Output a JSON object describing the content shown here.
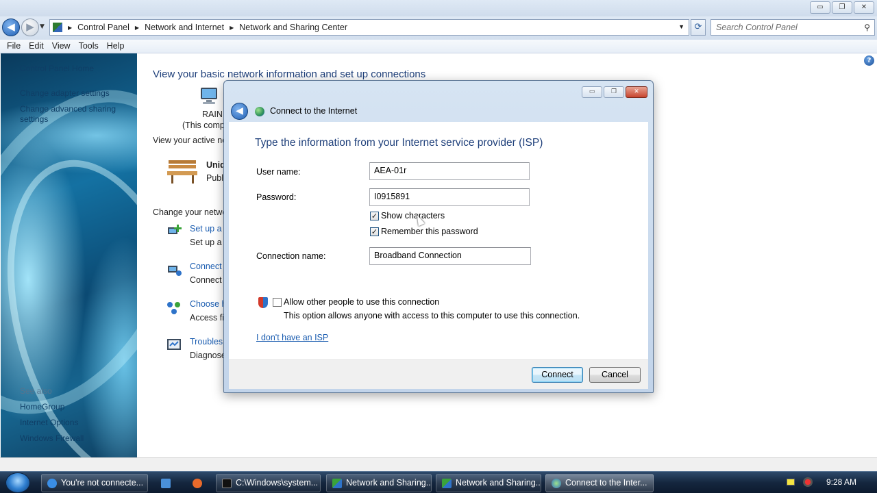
{
  "window": {
    "minimize": "▭",
    "maximize": "❐",
    "close": "✕"
  },
  "address": {
    "crumbs": [
      "Control Panel",
      "Network and Internet",
      "Network and Sharing Center"
    ],
    "search_placeholder": "Search Control Panel"
  },
  "menu": [
    "File",
    "Edit",
    "View",
    "Tools",
    "Help"
  ],
  "sidebar": {
    "links": [
      "Control Panel Home",
      "Change adapter settings",
      "Change advanced sharing settings"
    ],
    "see_also_title": "See also",
    "see_also": [
      "HomeGroup",
      "Internet Options",
      "Windows Firewall"
    ]
  },
  "main": {
    "title": "View your basic network information and set up connections",
    "computer_name": "RAIN",
    "computer_sub": "(This comp",
    "active_networks": "View your active ne",
    "network_name": "Unid",
    "network_type": "Publ",
    "change_settings": "Change your netwo",
    "tasks": [
      {
        "link": "Set up a n",
        "desc": "Set up a w"
      },
      {
        "link": "Connect t",
        "desc": "Connect"
      },
      {
        "link": "Choose h",
        "desc": "Access fil"
      },
      {
        "link": "Troublesh",
        "desc": "Diagnose"
      }
    ]
  },
  "dialog": {
    "title": "Connect to the Internet",
    "heading": "Type the information from your Internet service provider (ISP)",
    "username_label": "User name:",
    "username_value": "AEA-01r",
    "password_label": "Password:",
    "password_value": "I0915891",
    "show_chars_label": "Show characters",
    "show_chars_checked": true,
    "remember_label": "Remember this password",
    "remember_checked": true,
    "connection_label": "Connection name:",
    "connection_value": "Broadband Connection",
    "allow_label": "Allow other people to use this connection",
    "allow_checked": false,
    "allow_desc": "This option allows anyone with access to this computer to use this connection.",
    "no_isp_link": "I don't have an ISP",
    "connect_button": "Connect",
    "cancel_button": "Cancel",
    "check_glyph": "✓"
  },
  "taskbar": {
    "tasks": [
      "You're not connecte...",
      "C:\\Windows\\system...",
      "Network and Sharing...",
      "Network and Sharing...",
      "Connect to the Inter..."
    ],
    "clock": "9:28 AM"
  },
  "colors": {
    "link": "#1a5cb0",
    "heading": "#1e3f7a"
  }
}
